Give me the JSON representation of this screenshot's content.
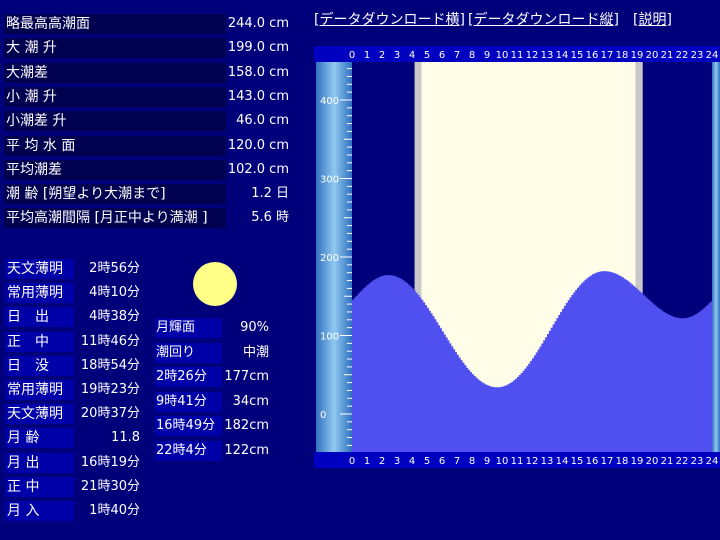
{
  "stats": [
    {
      "label": "略最高高潮面",
      "value": "244.0 cm"
    },
    {
      "label": "大 潮 升",
      "value": "199.0 cm"
    },
    {
      "label": "大潮差",
      "value": "158.0 cm"
    },
    {
      "label": "小 潮 升",
      "value": "143.0 cm"
    },
    {
      "label": "小潮差 升",
      "value": "46.0 cm"
    },
    {
      "label": "平 均 水 面",
      "value": "120.0 cm"
    },
    {
      "label": "平均潮差",
      "value": "102.0 cm"
    },
    {
      "label": "潮 齢 [朔望より大潮まで]",
      "value": "1.2 日"
    },
    {
      "label": "平均高潮間隔 [月正中より満潮 ]",
      "value": "5.6 時"
    }
  ],
  "events": [
    {
      "label": "天文薄明",
      "value": "2時56分"
    },
    {
      "label": "常用薄明",
      "value": "4時10分"
    },
    {
      "label": "日　出",
      "value": "4時38分"
    },
    {
      "label": "正　中",
      "value": "11時46分"
    },
    {
      "label": "日　没",
      "value": "18時54分"
    },
    {
      "label": "常用薄明",
      "value": "19時23分"
    },
    {
      "label": "天文薄明",
      "value": "20時37分"
    },
    {
      "label": "月 齢",
      "value": "11.8"
    },
    {
      "label": "月 出",
      "value": "16時19分"
    },
    {
      "label": "正 中",
      "value": "21時30分"
    },
    {
      "label": "月 入",
      "value": "1時40分"
    }
  ],
  "moon_info": [
    {
      "label": "月輝面",
      "value": "90%"
    },
    {
      "label": "潮回り",
      "value": "中潮"
    }
  ],
  "tides": [
    {
      "time": "2時26分",
      "value": "177cm"
    },
    {
      "time": "9時41分",
      "value": "34cm"
    },
    {
      "time": "16時49分",
      "value": "182cm"
    },
    {
      "time": "22時4分",
      "value": "122cm"
    }
  ],
  "links": {
    "download_h": "[データダウンロード横]",
    "download_v": "[データダウンロード縦]",
    "help": "[説明]"
  },
  "colors": {
    "background": "#00007a",
    "daylight": "#fffde8",
    "twilight": "#c8c8c8",
    "tide_fill": "#5050f0",
    "moon": "#ffff88"
  },
  "chart_data": {
    "type": "area",
    "x_label_hours": [
      "0",
      "1",
      "2",
      "3",
      "4",
      "5",
      "6",
      "7",
      "8",
      "9",
      "10",
      "11",
      "12",
      "13",
      "14",
      "15",
      "16",
      "17",
      "18",
      "19",
      "20",
      "21",
      "22",
      "23",
      "24"
    ],
    "y_ticks": [
      0,
      100,
      200,
      300,
      400
    ],
    "ylim": [
      -50,
      500
    ],
    "extrema": [
      {
        "hour": 2.43,
        "cm": 177
      },
      {
        "hour": 9.68,
        "cm": 34
      },
      {
        "hour": 16.82,
        "cm": 182
      },
      {
        "hour": 22.07,
        "cm": 122
      }
    ],
    "twilight_start_hour": 4.17,
    "sunrise_hour": 4.63,
    "sunset_hour": 18.9,
    "twilight_end_hour": 19.38
  }
}
